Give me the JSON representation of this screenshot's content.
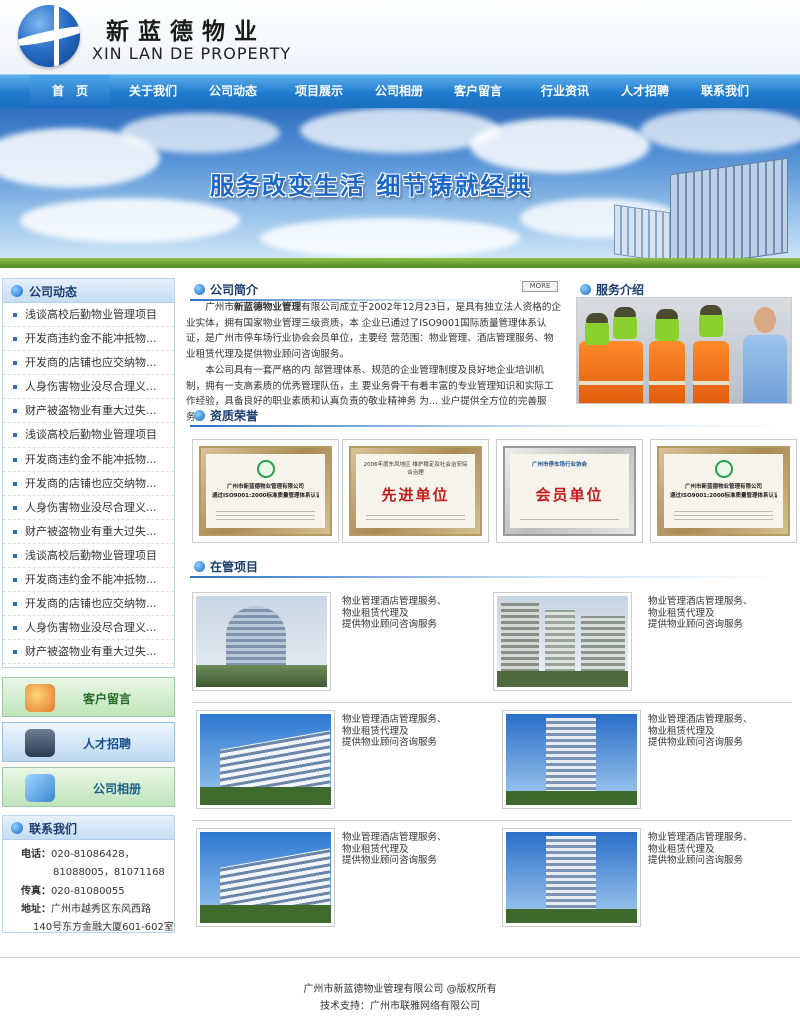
{
  "header": {
    "cn_name": "新蓝德物业",
    "en_name": "XIN LAN DE PROPERTY"
  },
  "nav": [
    "首　页",
    "关于我们",
    "公司动态",
    "项目展示",
    "公司相册",
    "客户留言",
    "行业资讯",
    "人才招聘",
    "联系我们"
  ],
  "banner": {
    "slogan": "服务改变生活  细节铸就经典"
  },
  "sidebar": {
    "news_title": "公司动态",
    "news": [
      "浅谈高校后勤物业管理项目",
      "开发商违约金不能冲抵物...",
      "开发商的店铺也应交纳物...",
      "人身伤害物业没尽合理义...",
      "财产被盗物业有重大过失...",
      "浅谈高校后勤物业管理项目",
      "开发商违约金不能冲抵物...",
      "开发商的店铺也应交纳物...",
      "人身伤害物业没尽合理义...",
      "财产被盗物业有重大过失...",
      "浅谈高校后勤物业管理项目",
      "开发商违约金不能冲抵物...",
      "开发商的店铺也应交纳物...",
      "人身伤害物业没尽合理义...",
      "财产被盗物业有重大过失..."
    ],
    "quick_links": [
      "客户留言",
      "人才招聘",
      "公司相册"
    ],
    "contact_title": "联系我们",
    "contact": {
      "phone_label": "电话：",
      "phone1": "020-81086428，",
      "phone2": "81088005，81071168",
      "fax_label": "传真：",
      "fax": "020-81080055",
      "addr_label": "地址：",
      "addr1": "广州市越秀区东风西路",
      "addr2": "140号东方金融大厦601-602室"
    }
  },
  "intro": {
    "title": "公司简介",
    "more": "MORE",
    "p1_pre": "广州市",
    "p1_company": "新蓝德物业管理",
    "p1_rest": "有限公司成立于2002年12月23日，是具有独立法人资格的企业实体，拥有国家物业管理三级资质，本 企业已通过了ISO9001国际质量管理体系认证，是广州市停车场行业协会会员单位，主要经 营范围：物业管理、酒店管理服务、物业租赁代理及提供物业顾问咨询服务。",
    "p2": "本公司具有一套严格的内 部管理体系、规范的企业管理制度及良好地企业培训机制，拥有一支高素质的优秀管理队伍，主 要业务骨干有着丰富的专业管理知识和实际工作经验，具备良好的职业素质和认真负责的敬业精神务 为...   业户提供全方位的完善服务。"
  },
  "service": {
    "title": "服务介绍"
  },
  "honors": {
    "title": "资质荣誉",
    "certs": [
      {
        "type": "iso",
        "line1": "广州市新蓝德物业管理有限公司",
        "line2": "通过ISO9001:2000标准质量管理体系认证"
      },
      {
        "type": "award",
        "small": "2006年度东风地区 维护稳定及社会治安综合治理",
        "big": "先进单位"
      },
      {
        "type": "member",
        "small": "广州市停车场行业协会",
        "big": "会员单位"
      },
      {
        "type": "iso",
        "line1": "广州市新蓝德物业管理有限公司",
        "line2": "通过ISO9001:2000标准质量管理体系认证"
      }
    ]
  },
  "projects": {
    "title": "在管项目",
    "desc": [
      "物业管理酒店管理服务、",
      "物业租赁代理及",
      "提供物业顾问咨询服务"
    ]
  },
  "footer": {
    "line1": "广州市新蓝德物业管理有限公司 @版权所有",
    "line2": "技术支持：广州市联雅网络有限公司"
  },
  "colors": {
    "nav_blue": "#1f7bcf",
    "title_blue": "#1a3c6e",
    "cert_red": "#c21c1c"
  }
}
